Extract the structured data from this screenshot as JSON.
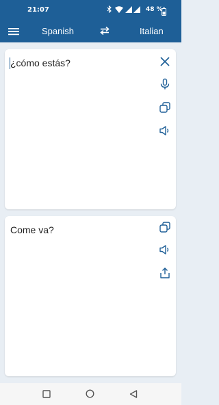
{
  "status_bar": {
    "time": "21:07",
    "battery": "48 %",
    "icons": [
      "bluetooth-icon",
      "wifi-icon",
      "signal-icon",
      "signal-icon",
      "battery-icon"
    ]
  },
  "app_bar": {
    "source_language": "Spanish",
    "target_language": "Italian",
    "icons": [
      "menu-icon",
      "swap-languages-icon"
    ]
  },
  "input_card": {
    "text": "¿cómo estás?",
    "icons": [
      "close-icon",
      "microphone-icon",
      "copy-icon",
      "speaker-icon"
    ]
  },
  "output_card": {
    "text": "Come va?",
    "icons": [
      "copy-icon",
      "speaker-icon",
      "share-icon"
    ]
  },
  "nav_bar": {
    "icons": [
      "recents-square-icon",
      "home-circle-icon",
      "back-triangle-icon"
    ]
  },
  "colors": {
    "primary": "#1e5f97",
    "background": "#e8eef4",
    "card": "#ffffff",
    "icon": "#1e5f97"
  }
}
